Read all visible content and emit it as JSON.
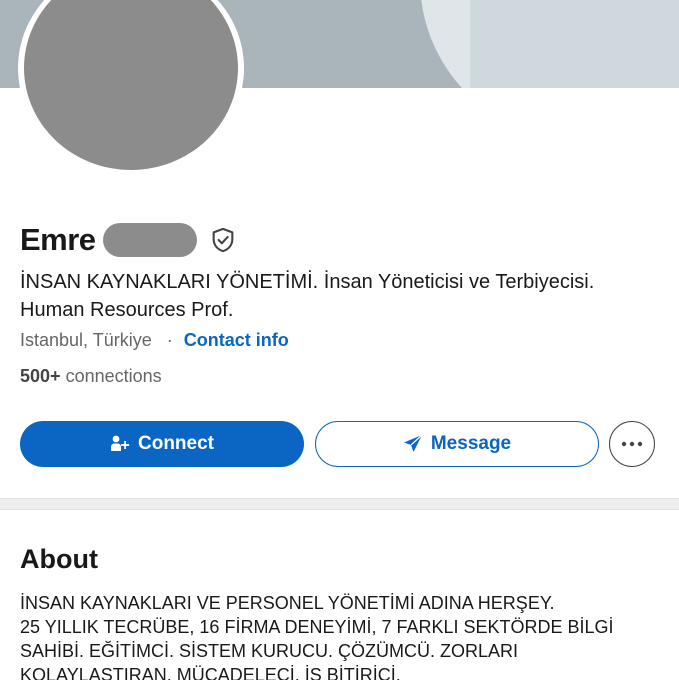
{
  "profile": {
    "name": "Emre",
    "headline_line1": "İNSAN KAYNAKLARI YÖNETİMİ. İnsan Yöneticisi ve Terbiyecisi.",
    "headline_line2": "Human Resources Prof.",
    "location": "Istanbul, Türkiye",
    "separator": "·",
    "contact_info": "Contact info",
    "connections_count": "500+",
    "connections_label": "connections"
  },
  "actions": {
    "connect_label": "Connect",
    "message_label": "Message",
    "more_icon": "ellipsis-icon"
  },
  "icons": {
    "verified": "shield-check-icon",
    "connect": "add-person-icon",
    "message": "send-icon"
  },
  "about": {
    "title": "About",
    "lines": [
      "İNSAN KAYNAKLARI VE PERSONEL YÖNETİMİ ADINA HERŞEY.",
      "25 YILLIK TECRÜBE, 16 FİRMA DENEYİMİ, 7 FARKLI SEKTÖRDE BİLGİ",
      "SAHİBİ. EĞİTİMCİ. SİSTEM KURUCU. ÇÖZÜMCÜ. ZORLARI",
      "KOLAYLAŞTIRAN. MÜCADELECİ. İŞ BİTİRİCİ."
    ]
  },
  "colors": {
    "accent": "#0a66c2",
    "banner": "#a9b4bb",
    "placeholder_gray": "#8c8c8c",
    "secondary_text": "#666666"
  }
}
